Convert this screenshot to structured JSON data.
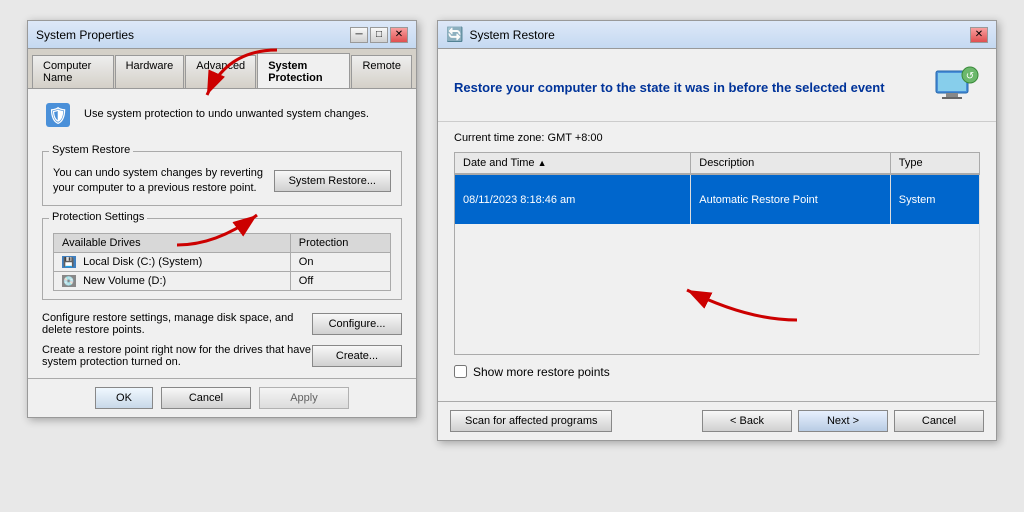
{
  "sysprop": {
    "title": "System Properties",
    "tabs": [
      "Computer Name",
      "Hardware",
      "Advanced",
      "System Protection",
      "Remote"
    ],
    "active_tab": "System Protection",
    "desc_text": "Use system protection to undo unwanted system changes.",
    "system_restore_section": "System Restore",
    "system_restore_text": "You can undo system changes by reverting your computer to a previous restore point.",
    "system_restore_btn": "System Restore...",
    "protection_settings_section": "Protection Settings",
    "col_drives": "Available Drives",
    "col_protection": "Protection",
    "drives": [
      {
        "name": "Local Disk (C:) (System)",
        "protection": "On",
        "icon": "C"
      },
      {
        "name": "New Volume (D:)",
        "protection": "Off",
        "icon": "D"
      }
    ],
    "configure_text": "Configure restore settings, manage disk space, and delete restore points.",
    "configure_btn": "Configure...",
    "create_text": "Create a restore point right now for the drives that have system protection turned on.",
    "create_btn": "Create...",
    "ok_btn": "OK",
    "cancel_btn": "Cancel",
    "apply_btn": "Apply"
  },
  "sysrestore": {
    "title": "System Restore",
    "header": "Restore your computer to the state it was in before the selected event",
    "timezone": "Current time zone: GMT +8:00",
    "col_date": "Date and Time",
    "col_description": "Description",
    "col_type": "Type",
    "rows": [
      {
        "date": "08/11/2023 8:18:46 am",
        "description": "Automatic Restore Point",
        "type": "System",
        "selected": true
      }
    ],
    "show_more_label": "Show more restore points",
    "scan_btn": "Scan for affected programs",
    "back_btn": "< Back",
    "next_btn": "Next >",
    "cancel_btn": "Cancel"
  }
}
